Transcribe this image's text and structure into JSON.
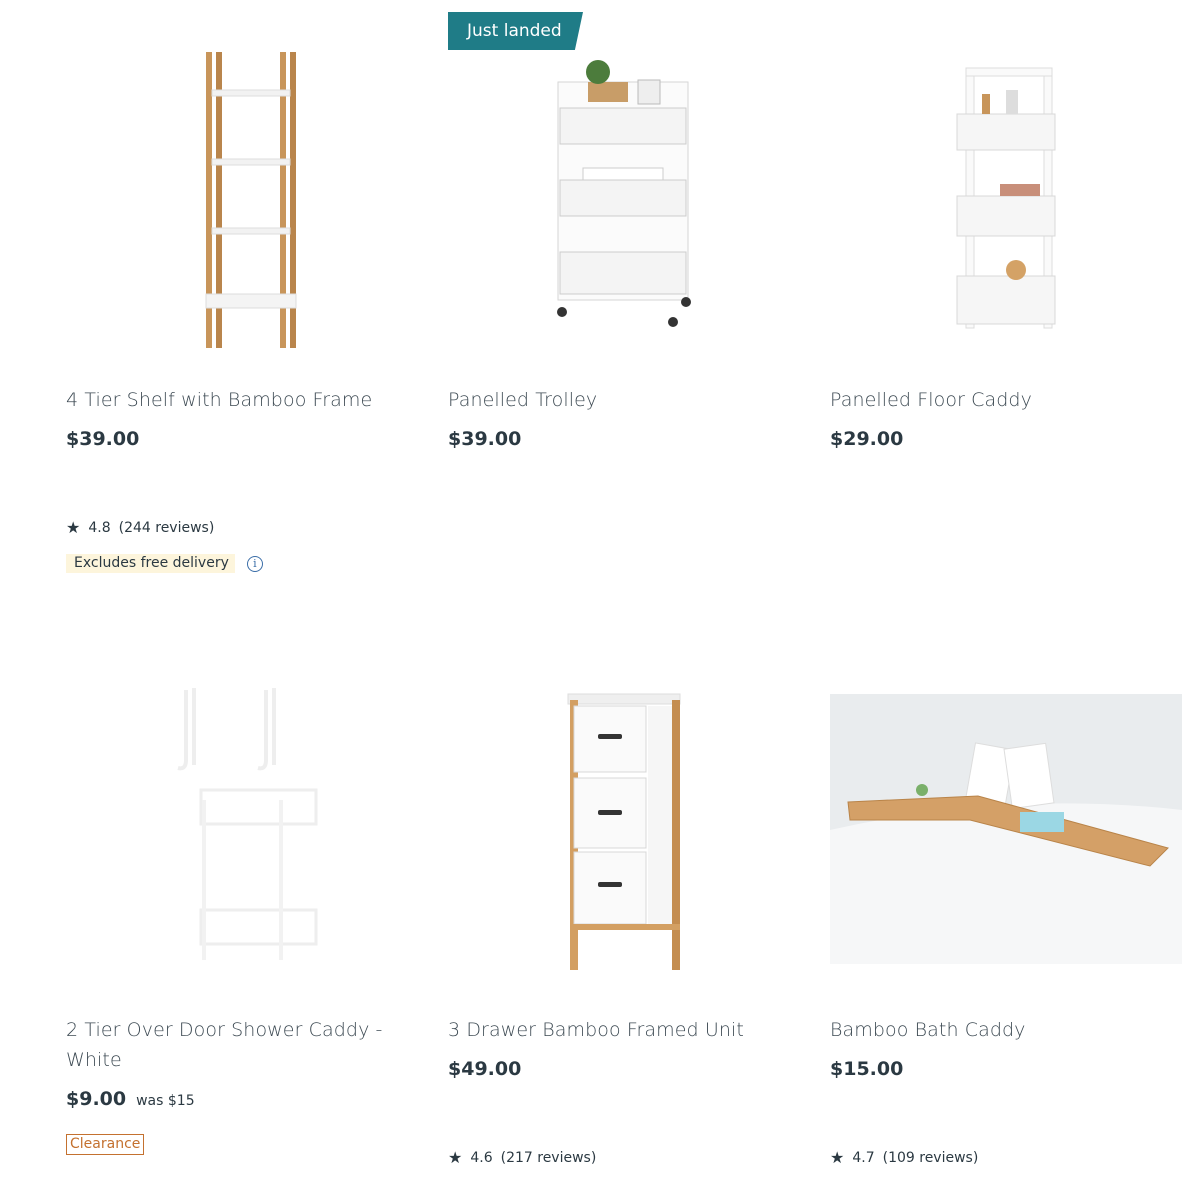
{
  "products": [
    {
      "title": "4 Tier Shelf with Bamboo Frame",
      "price": "$39.00",
      "rating": "4.8",
      "reviews": "(244 reviews)",
      "note": "Excludes free delivery",
      "image_icon": "bamboo-shelf-image"
    },
    {
      "badge": "Just landed",
      "title": "Panelled Trolley",
      "price": "$39.00",
      "image_icon": "trolley-image"
    },
    {
      "title": "Panelled Floor Caddy",
      "price": "$29.00",
      "image_icon": "floor-caddy-image"
    },
    {
      "title_line1": "2 Tier Over Door Shower Caddy -",
      "title_line2": "White",
      "price": "$9.00",
      "was": "was $15",
      "tag": "Clearance",
      "image_icon": "shower-caddy-image"
    },
    {
      "title": "3 Drawer Bamboo Framed Unit",
      "price": "$49.00",
      "rating": "4.6",
      "reviews": "(217 reviews)",
      "image_icon": "drawer-unit-image"
    },
    {
      "title": "Bamboo Bath Caddy",
      "price": "$15.00",
      "rating": "4.7",
      "reviews": "(109 reviews)",
      "image_icon": "bath-caddy-image"
    }
  ],
  "colors": {
    "badge": "#1f7c87",
    "clearance": "#c4712f",
    "note_bg": "#fdf5dc",
    "info": "#3b6ea8"
  }
}
